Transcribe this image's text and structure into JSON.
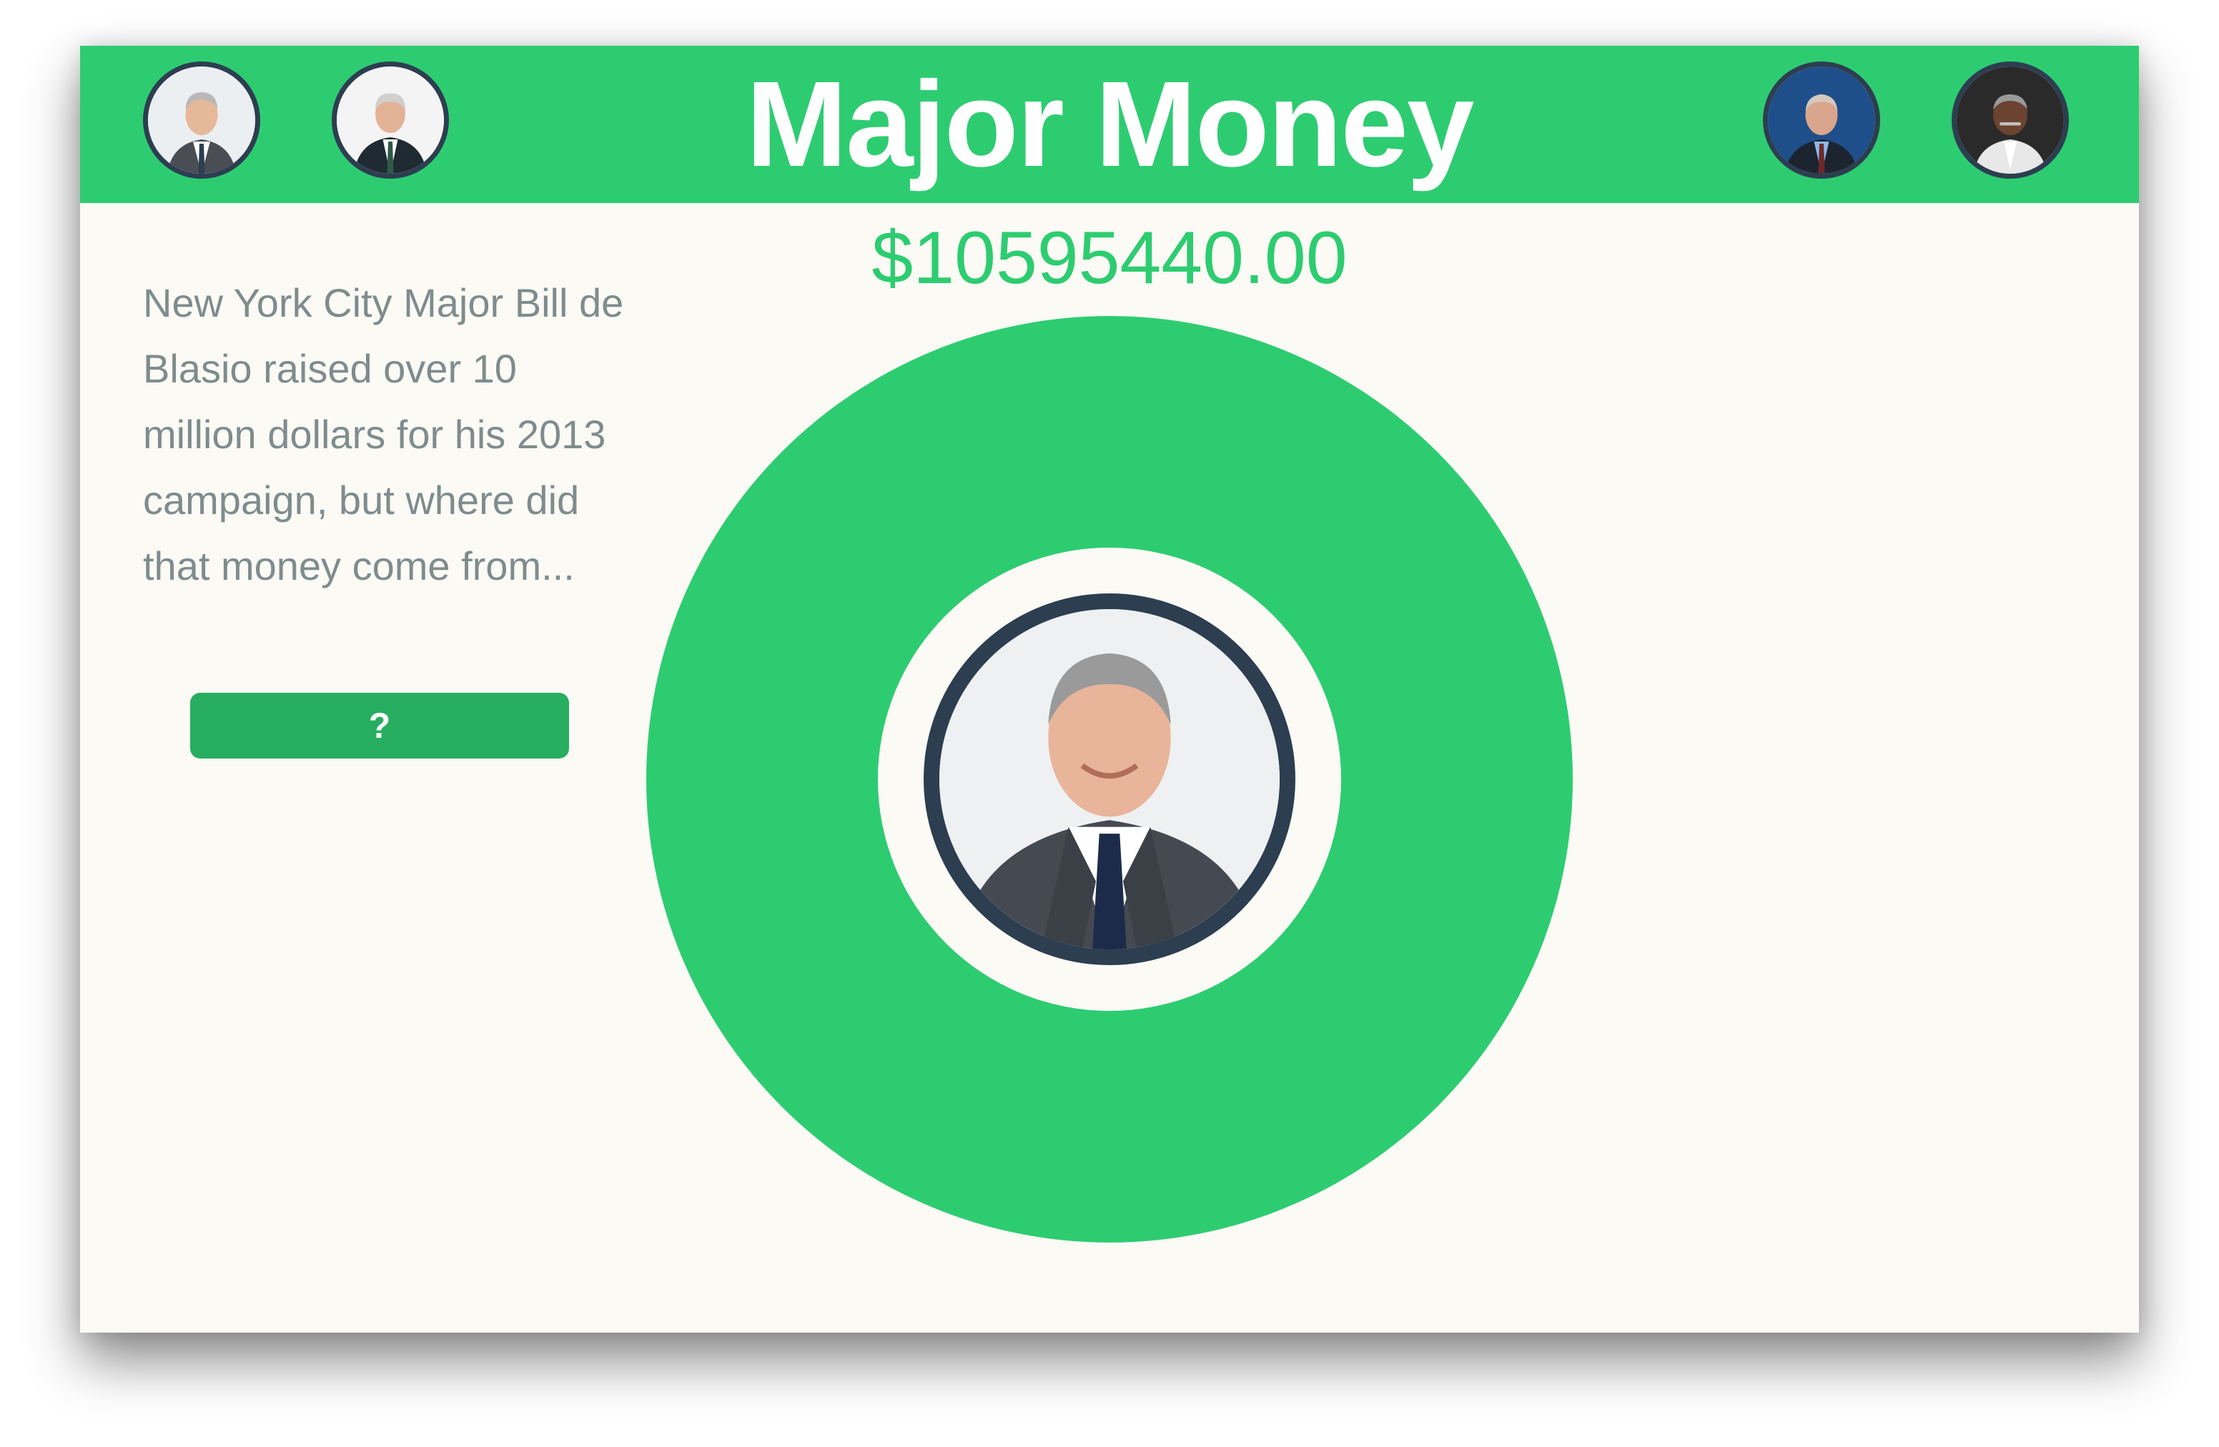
{
  "header": {
    "title": "Major Money",
    "background_color": "#2ecc71",
    "avatars": [
      {
        "name": "mayor-avatar-1",
        "icon": "portrait-icon"
      },
      {
        "name": "mayor-avatar-2",
        "icon": "portrait-icon"
      },
      {
        "name": "mayor-avatar-3",
        "icon": "portrait-icon"
      },
      {
        "name": "mayor-avatar-4",
        "icon": "portrait-icon"
      }
    ]
  },
  "summary": {
    "amount": "$10595440.00",
    "description": "New York City Major Bill de Blasio raised over 10 million dollars for his 2013 campaign, but where did that money come from...",
    "help_button_label": "?"
  },
  "chart_data": {
    "type": "pie",
    "categories": [
      ""
    ],
    "values": [
      10595440.0
    ],
    "colors": [
      "#2ecc71"
    ],
    "title": ""
  },
  "colors": {
    "accent": "#2ecc71",
    "button": "#27ae60",
    "border": "#2c3e50",
    "text_muted": "#7f8c8d",
    "background": "#fbfaf5"
  }
}
